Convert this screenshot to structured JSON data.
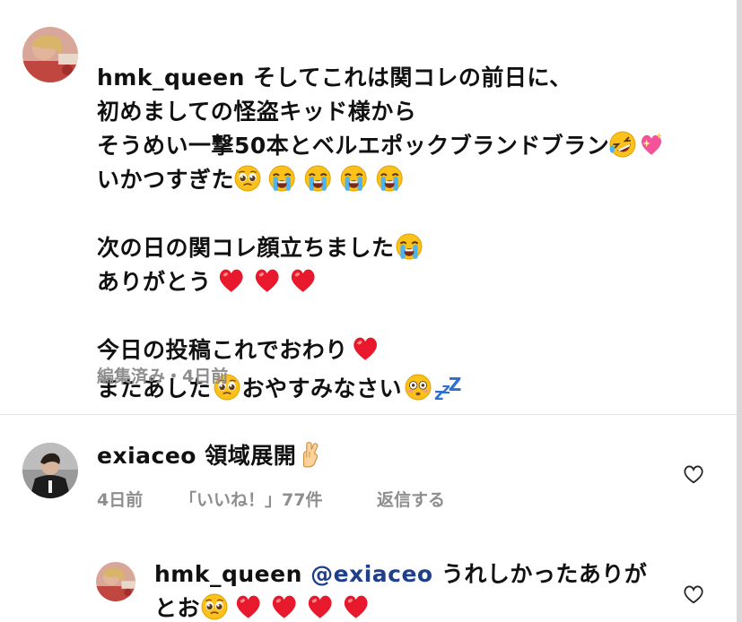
{
  "comments": [
    {
      "username": "hmk_queen",
      "lines": [
        "そしてこれは関コレの前日に、",
        "初めましての怪盗キッド様から",
        "そうめい一撃50本とベルエポックブランドブラン",
        "いかつすぎた",
        "",
        "次の日の関コレ顔立ちました",
        "ありがとう",
        "",
        "今日の投稿これでおわり",
        "またあした",
        "おやすみなさい"
      ],
      "meta": "編集済み・4日前"
    },
    {
      "username": "exiaceo",
      "text": "領域展開",
      "time": "4日前",
      "likes": "「いいね！」77件",
      "reply": "返信する"
    },
    {
      "username": "hmk_queen",
      "mention": "@exiaceo",
      "text_line1": "うれしかったありが",
      "text_line2": "とお"
    }
  ],
  "icons": [
    "pleading-face",
    "loudly-crying-face",
    "rolling-on-floor-laughing",
    "sparkling-heart",
    "red-heart",
    "flushed-face",
    "zzz",
    "crossed-fingers",
    "heart-outline"
  ]
}
